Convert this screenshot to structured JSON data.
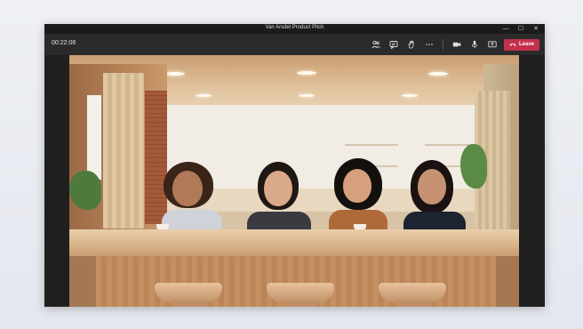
{
  "window": {
    "title": "Van Arsdel Product Pitch",
    "controls": {
      "minimize": "—",
      "maximize": "☐",
      "close": "✕"
    }
  },
  "toolbar": {
    "timer": "00:22:06",
    "leave_label": "Leave",
    "icons": [
      "people-icon",
      "chat-icon",
      "raise-hand-icon",
      "more-icon",
      "camera-icon",
      "microphone-icon",
      "share-icon"
    ]
  },
  "colors": {
    "leave_button": "#c4314b",
    "toolbar_bg": "#2a2a2a",
    "titlebar_bg": "#1b1b1b"
  },
  "stage": {
    "mode": "together-mode",
    "participants": 4
  }
}
